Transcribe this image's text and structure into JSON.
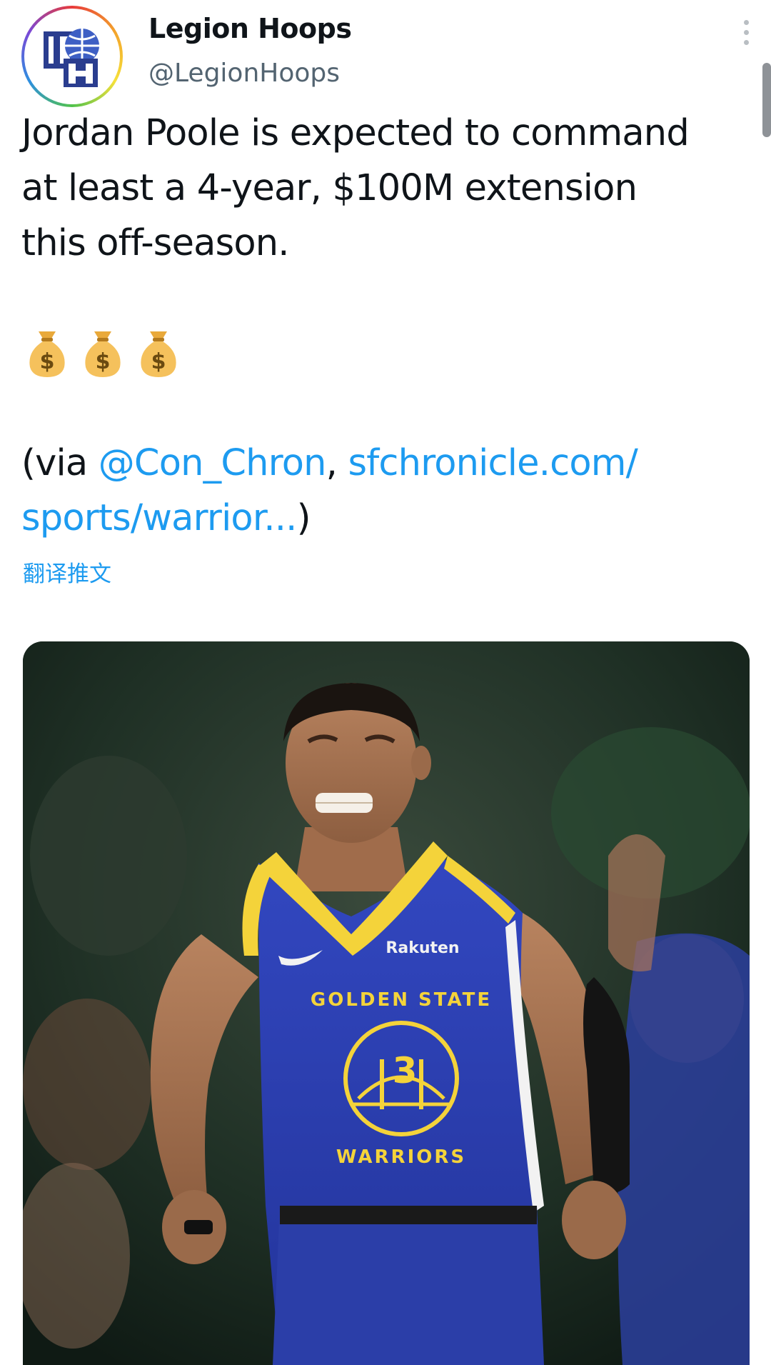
{
  "tweet": {
    "author_name": "Legion Hoops",
    "author_handle": "@LegionHoops",
    "avatar_initials": "LH",
    "text_lines": [
      "Jordan Poole is expected to command",
      "at least a 4-year, $100M extension",
      "this off-season."
    ],
    "emoji": [
      "money-bag",
      "money-bag",
      "money-bag"
    ],
    "via_prefix": "(via ",
    "via_mention": "@Con_Chron",
    "via_sep": ", ",
    "via_link_line1": "sfchronicle.com/",
    "via_link_line2": "sports/warrior...",
    "via_suffix": ")",
    "translate_label": "翻译推文"
  },
  "photo": {
    "jersey_wordmark_top": "GOLDEN STATE",
    "jersey_wordmark_bottom": "WARRIORS",
    "jersey_number": "3",
    "jersey_sponsor": "Rakuten"
  },
  "colors": {
    "text": "#0f1419",
    "secondary": "#536471",
    "link": "#1d9bf0",
    "jersey_blue": "#2d3fb0",
    "jersey_yellow": "#f4d33a"
  }
}
